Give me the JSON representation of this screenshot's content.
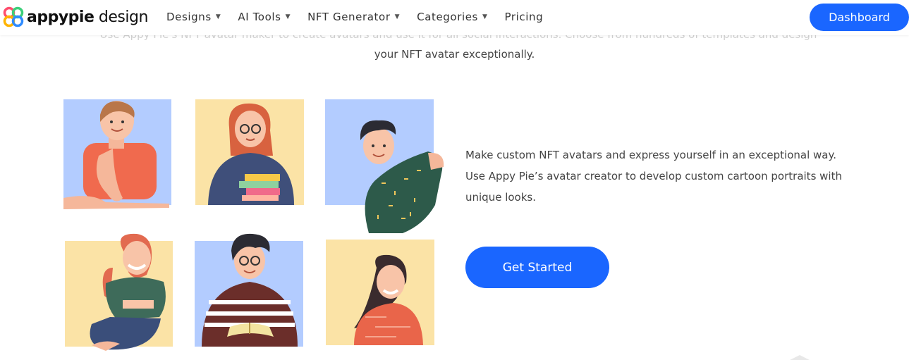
{
  "brand": {
    "name_bold": "appypie",
    "name_light": " design"
  },
  "nav": [
    {
      "label": "Designs",
      "has_caret": true
    },
    {
      "label": "AI Tools",
      "has_caret": true
    },
    {
      "label": "NFT Generator",
      "has_caret": true
    },
    {
      "label": "Categories",
      "has_caret": true
    },
    {
      "label": "Pricing",
      "has_caret": false
    }
  ],
  "dashboard_label": "Dashboard",
  "intro_line_hidden": "Use Appy Pie's NFT avatar maker to create avatars and use it for all social interactions. Choose from hundreds of templates and design",
  "intro_line": "your NFT avatar exceptionally.",
  "description": "Make custom NFT avatars and express yourself in an exceptional way. Use Appy Pie’s avatar creator to develop custom cartoon portraits with unique looks.",
  "cta_label": "Get Started",
  "colors": {
    "accent": "#1a66ff",
    "tile_blue": "#b3ccff",
    "tile_yellow": "#fbe3a6"
  }
}
